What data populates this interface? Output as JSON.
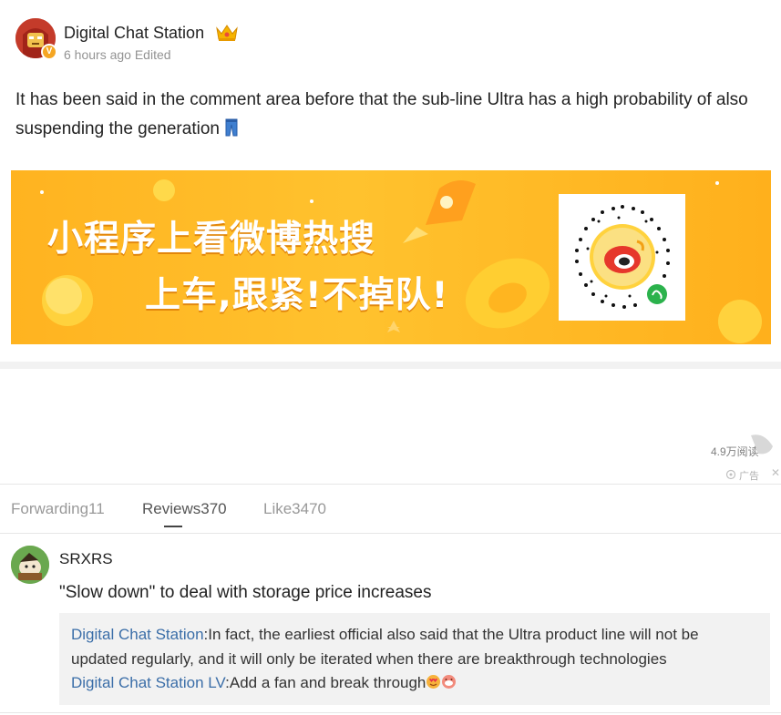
{
  "post": {
    "author": "Digital Chat Station",
    "time": "6 hours ago",
    "edited": "Edited",
    "text": "It has been said in the comment area before that the sub-line Ultra has a high probability of also suspending the generation"
  },
  "banner": {
    "line1": "小程序上看微博热搜",
    "line2": "上车,跟紧!不掉队!"
  },
  "stats": {
    "views": "4.9万阅读",
    "ad_label": "广告",
    "ad_close": "✕"
  },
  "tabs": [
    {
      "label": "Forwarding11"
    },
    {
      "label": "Reviews370"
    },
    {
      "label": "Like3470"
    }
  ],
  "comment": {
    "user": "SRXRS",
    "text": "\"Slow down\" to deal with storage price increases",
    "replies": [
      {
        "name": "Digital Chat Station",
        "sep": ":",
        "text": "In fact, the earliest official also said that the Ultra product line will not be"
      },
      {
        "name": "",
        "sep": "",
        "text": "updated regularly, and it will only be iterated when there are breakthrough technologies"
      },
      {
        "name": "Digital Chat Station LV",
        "sep": ":",
        "text": "Add a fan and break through"
      }
    ]
  },
  "colors": {
    "link": "#3b6ea8",
    "banner": "#ffb320"
  }
}
